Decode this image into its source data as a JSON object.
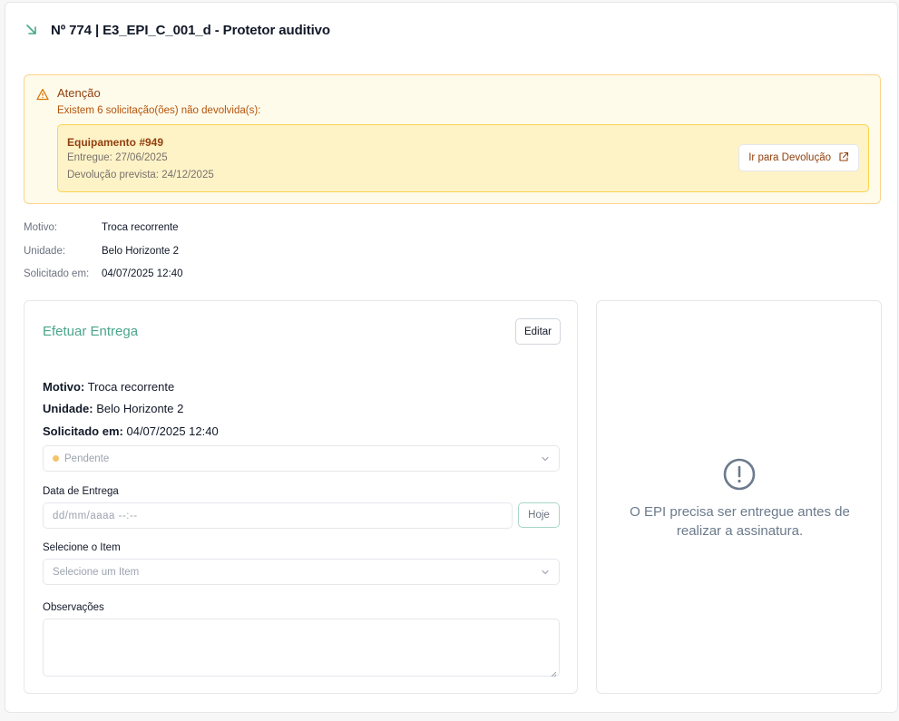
{
  "header": {
    "title": "Nº 774 | E3_EPI_C_001_d - Protetor auditivo",
    "icon": "arrow-down-right-icon"
  },
  "alert": {
    "title": "Atenção",
    "message": "Existem 6 solicitação(ões) não devolvida(s):",
    "item": {
      "equipment": "Equipamento #949",
      "delivered": "Entregue: 27/06/2025",
      "expected_return": "Devolução prevista: 24/12/2025",
      "button_label": "Ir para Devolução"
    }
  },
  "details": {
    "motivo_label": "Motivo:",
    "motivo": "Troca recorrente",
    "unidade_label": "Unidade:",
    "unidade": "Belo Horizonte 2",
    "solicitado_label": "Solicitado em:",
    "solicitado": "04/07/2025 12:40"
  },
  "delivery": {
    "title": "Efetuar Entrega",
    "edit_label": "Editar",
    "motivo_label": "Motivo:",
    "motivo": "Troca recorrente",
    "unidade_label": "Unidade:",
    "unidade": "Belo Horizonte 2",
    "solicitado_label": "Solicitado em:",
    "solicitado": "04/07/2025 12:40",
    "status": "Pendente",
    "date_label": "Data de Entrega",
    "date_placeholder": "dd/mm/aaaa --:--",
    "today_label": "Hoje",
    "item_label": "Selecione o Item",
    "item_placeholder": "Selecione um Item",
    "notes_label": "Observações"
  },
  "signature": {
    "message": "O EPI precisa ser entregue antes de realizar a assinatura.",
    "icon": "alert-circle-icon"
  },
  "colors": {
    "accent": "#4aa58a",
    "warning_bg": "#fffbeb",
    "warning_text": "#92400e",
    "status_pending": "#f6c36b"
  }
}
